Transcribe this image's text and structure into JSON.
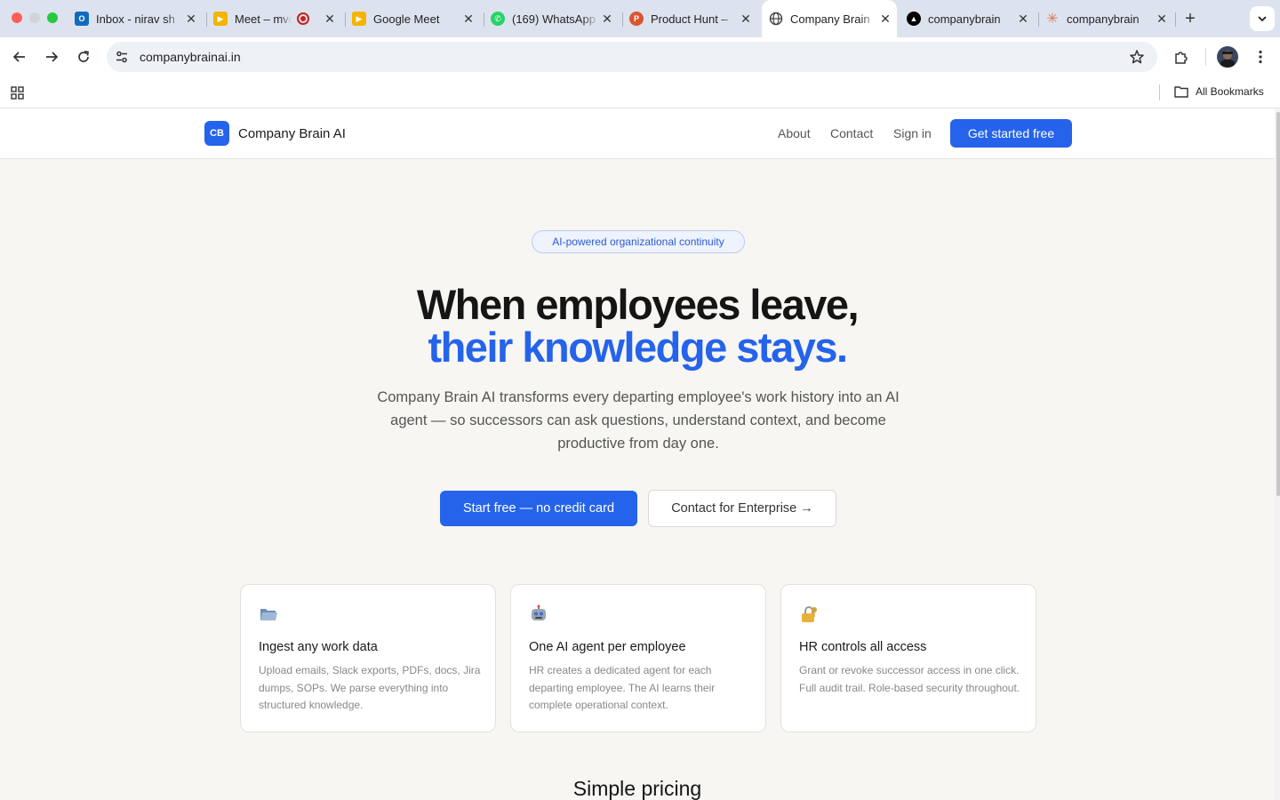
{
  "browser": {
    "tabs": [
      {
        "title": "Inbox - nirav sh",
        "favicon": "outlook-icon",
        "color": "#0f6cbd",
        "active": false
      },
      {
        "title": "Meet – mvc",
        "favicon": "google-meet-icon",
        "color": "#f4b400",
        "active": false,
        "recording": true
      },
      {
        "title": "Google Meet",
        "favicon": "google-meet-icon",
        "color": "#f4b400",
        "active": false
      },
      {
        "title": "(169) WhatsApp",
        "favicon": "whatsapp-icon",
        "color": "#25d366",
        "active": false
      },
      {
        "title": "Product Hunt –",
        "favicon": "product-hunt-icon",
        "color": "#da552f",
        "active": false
      },
      {
        "title": "Company Brain",
        "favicon": "globe-icon",
        "color": "#5f6368",
        "active": true
      },
      {
        "title": "companybrain",
        "favicon": "vercel-icon",
        "color": "#000000",
        "active": false
      },
      {
        "title": "companybrain",
        "favicon": "claude-icon",
        "color": "#d97757",
        "active": false
      }
    ],
    "address": "companybrainai.in",
    "bookmarks_label": "All Bookmarks"
  },
  "site": {
    "logo_badge": "CB",
    "logo_text": "Company Brain AI",
    "nav": {
      "about": "About",
      "contact": "Contact",
      "signin": "Sign in",
      "cta": "Get started free"
    },
    "hero": {
      "pill": "AI-powered organizational continuity",
      "headline_1": "When employees leave,",
      "headline_2": "their knowledge stays.",
      "subtext": "Company Brain AI transforms every departing employee's work history into an AI agent — so successors can ask questions, understand context, and become productive from day one.",
      "primary_button": "Start free — no credit card",
      "secondary_button": "Contact for Enterprise →"
    },
    "features": [
      {
        "icon": "folder-icon",
        "title": "Ingest any work data",
        "description": "Upload emails, Slack exports, PDFs, docs, Jira dumps, SOPs. We parse everything into structured knowledge."
      },
      {
        "icon": "robot-icon",
        "title": "One AI agent per employee",
        "description": "HR creates a dedicated agent for each departing employee. The AI learns their complete operational context."
      },
      {
        "icon": "lock-icon",
        "title": "HR controls all access",
        "description": "Grant or revoke successor access in one click. Full audit trail. Role-based security throughout."
      }
    ],
    "pricing_heading": "Simple pricing"
  },
  "colors": {
    "accent": "#2563eb",
    "page_bg": "#f7f6f3"
  }
}
